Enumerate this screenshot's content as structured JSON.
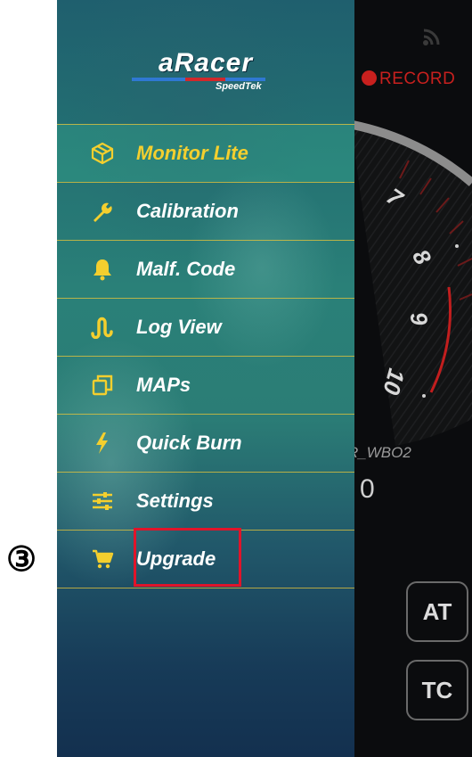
{
  "app": {
    "logo_main": "aRacer",
    "logo_sub": "SpeedTek"
  },
  "dashboard": {
    "record_label": "RECORD",
    "gauge_ticks": [
      "7",
      "8",
      "9",
      "10"
    ],
    "sensor_label": "R_WBO2",
    "sensor_value": "0",
    "at_button": "AT",
    "tc_button": "TC"
  },
  "menu": {
    "items": [
      {
        "label": "Monitor Lite",
        "icon": "cube-icon",
        "selected": true
      },
      {
        "label": "Calibration",
        "icon": "wrench-icon"
      },
      {
        "label": "Malf. Code",
        "icon": "bell-icon"
      },
      {
        "label": "Log View",
        "icon": "waveform-icon"
      },
      {
        "label": "MAPs",
        "icon": "copy-icon"
      },
      {
        "label": "Quick Burn",
        "icon": "lightning-icon"
      },
      {
        "label": "Settings",
        "icon": "sliders-icon"
      },
      {
        "label": "Upgrade",
        "icon": "cart-icon"
      }
    ]
  },
  "annotation": {
    "step_marker": "③"
  },
  "colors": {
    "accent_yellow": "#f4cf2e",
    "record_red": "#c8201e",
    "highlight_red": "#e0142a"
  }
}
